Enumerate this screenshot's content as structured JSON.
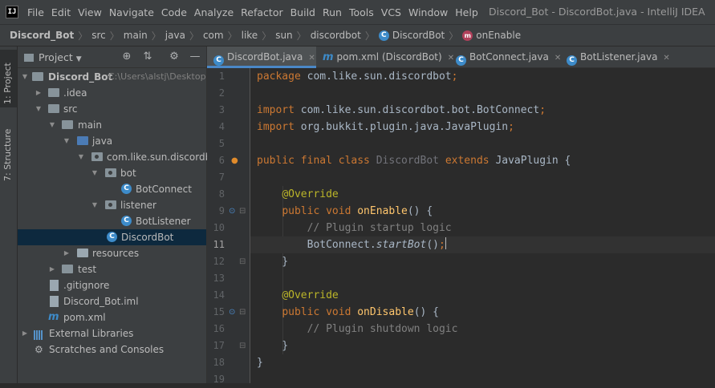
{
  "menubar": {
    "logo": "IJ",
    "items": [
      "File",
      "Edit",
      "View",
      "Navigate",
      "Code",
      "Analyze",
      "Refactor",
      "Build",
      "Run",
      "Tools",
      "VCS",
      "Window",
      "Help"
    ],
    "window_title": "Discord_Bot - DiscordBot.java - IntelliJ IDEA"
  },
  "breadcrumb": [
    "Discord_Bot",
    "src",
    "main",
    "java",
    "com",
    "like",
    "sun",
    "discordbot",
    "DiscordBot",
    "onEnable"
  ],
  "tool_stripe": {
    "project_tab": "1: Project",
    "structure_tab": "7: Structure"
  },
  "project_panel": {
    "title": "Project",
    "tree": [
      {
        "label": "Discord_Bot",
        "hint": "C:\\Users\\alstj\\Desktop"
      },
      {
        "label": ".idea"
      },
      {
        "label": "src"
      },
      {
        "label": "main"
      },
      {
        "label": "java"
      },
      {
        "label": "com.like.sun.discordbot"
      },
      {
        "label": "bot"
      },
      {
        "label": "BotConnect"
      },
      {
        "label": "listener"
      },
      {
        "label": "BotListener"
      },
      {
        "label": "DiscordBot"
      },
      {
        "label": "resources"
      },
      {
        "label": "test"
      },
      {
        "label": ".gitignore"
      },
      {
        "label": "Discord_Bot.iml"
      },
      {
        "label": "pom.xml"
      },
      {
        "label": "External Libraries"
      },
      {
        "label": "Scratches and Consoles"
      }
    ]
  },
  "editor": {
    "tabs": [
      {
        "label": "DiscordBot.java",
        "active": true
      },
      {
        "label": "pom.xml (DiscordBot)"
      },
      {
        "label": "BotConnect.java"
      },
      {
        "label": "BotListener.java"
      }
    ],
    "current_line": 11,
    "lines": [
      [
        {
          "t": "package",
          "c": "kw"
        },
        {
          "t": " com.like.sun.discordbot"
        },
        {
          "t": ";",
          "c": "kw"
        }
      ],
      [],
      [
        {
          "t": "import",
          "c": "kw"
        },
        {
          "t": " com.like.sun.discordbot.bot.BotConnect"
        },
        {
          "t": ";",
          "c": "kw"
        }
      ],
      [
        {
          "t": "import",
          "c": "kw"
        },
        {
          "t": " org.bukkit.plugin.java.JavaPlugin"
        },
        {
          "t": ";",
          "c": "kw"
        }
      ],
      [],
      [
        {
          "t": "public final class",
          "c": "kw"
        },
        {
          "t": " "
        },
        {
          "t": "DiscordBot",
          "c": "gray"
        },
        {
          "t": " "
        },
        {
          "t": "extends",
          "c": "kw"
        },
        {
          "t": " JavaPlugin {"
        }
      ],
      [],
      [
        {
          "t": "    "
        },
        {
          "t": "@Override",
          "c": "ann"
        }
      ],
      [
        {
          "t": "    "
        },
        {
          "t": "public void",
          "c": "kw"
        },
        {
          "t": " "
        },
        {
          "t": "onEnable",
          "c": "fn"
        },
        {
          "t": "() {"
        }
      ],
      [
        {
          "t": "        "
        },
        {
          "t": "// Plugin startup logic",
          "c": "cm"
        }
      ],
      [
        {
          "t": "        BotConnect."
        },
        {
          "t": "startBot",
          "c": "it"
        },
        {
          "t": "()"
        },
        {
          "t": ";",
          "c": "kw"
        }
      ],
      [
        {
          "t": "    }"
        }
      ],
      [],
      [
        {
          "t": "    "
        },
        {
          "t": "@Override",
          "c": "ann"
        }
      ],
      [
        {
          "t": "    "
        },
        {
          "t": "public void",
          "c": "kw"
        },
        {
          "t": " "
        },
        {
          "t": "onDisable",
          "c": "fn"
        },
        {
          "t": "() {"
        }
      ],
      [
        {
          "t": "        "
        },
        {
          "t": "// Plugin shutdown logic",
          "c": "cm"
        }
      ],
      [
        {
          "t": "    }"
        }
      ],
      [
        {
          "t": "}"
        }
      ],
      []
    ]
  }
}
